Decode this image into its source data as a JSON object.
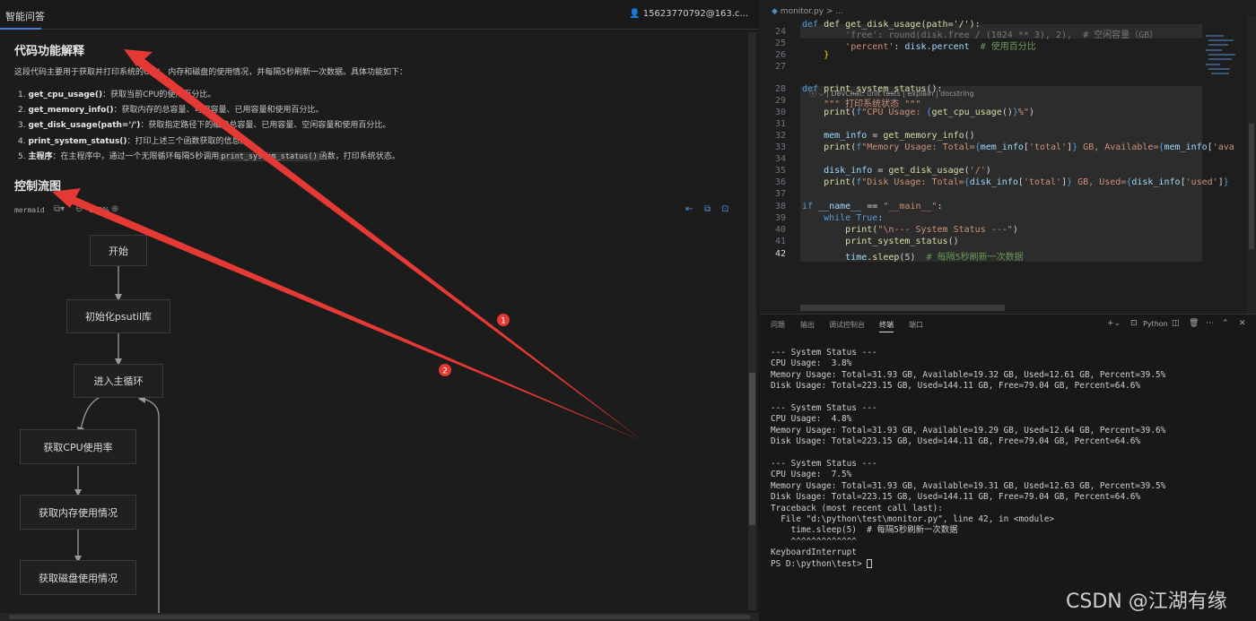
{
  "left_panel": {
    "tab_title": "智能问答",
    "user": "15623770792@163.c...",
    "section1_title": "代码功能解释",
    "intro": "这段代码主要用于获取并打印系统的CPU、内存和磁盘的使用情况，并每隔5秒刷新一次数据。具体功能如下：",
    "items": [
      {
        "num": "1.",
        "name": "get_cpu_usage()",
        "desc": "：获取当前CPU的使用百分比。"
      },
      {
        "num": "2.",
        "name": "get_memory_info()",
        "desc": "：获取内存的总容量、可用容量、已用容量和使用百分比。"
      },
      {
        "num": "3.",
        "name": "get_disk_usage(path='/')",
        "desc": "：获取指定路径下的磁盘总容量、已用容量、空闲容量和使用百分比。"
      },
      {
        "num": "4.",
        "name": "print_system_status()",
        "desc": "：打印上述三个函数获取的信息。"
      },
      {
        "num": "5.",
        "name": "主程序",
        "desc_a": "：在主程序中，通过一个无限循环每隔5秒调用",
        "code": "print_system_status()",
        "desc_b": "函数，打印系统状态。"
      }
    ],
    "section2_title": "控制流图",
    "mermaid_label": "mermaid",
    "zoom": "100%",
    "flow_nodes": [
      "开始",
      "初始化psutil库",
      "进入主循环",
      "获取CPU使用率",
      "获取内存使用情况",
      "获取磁盘使用情况"
    ]
  },
  "editor": {
    "breadcrumb": "monitor.py > ...",
    "codelens": "ⓘ ⌵ | DevChat: unit tests | explain | docstring",
    "line_numbers": [
      "24",
      "25",
      "26",
      "27",
      "28",
      "29",
      "30",
      "31",
      "32",
      "33",
      "34",
      "35",
      "36",
      "37",
      "38",
      "39",
      "40",
      "41",
      "42"
    ],
    "top_line": "def get_disk_usage(path='/'):"
  },
  "panel": {
    "tabs": [
      "问题",
      "输出",
      "调试控制台",
      "终端",
      "端口"
    ],
    "active_tab": "终端",
    "shell": "Python",
    "terminal_lines": [
      "--- System Status ---",
      "CPU Usage:  3.8%",
      "Memory Usage: Total=31.93 GB, Available=19.32 GB, Used=12.61 GB, Percent=39.5%",
      "Disk Usage: Total=223.15 GB, Used=144.11 GB, Free=79.04 GB, Percent=64.6%",
      "",
      "--- System Status ---",
      "CPU Usage:  4.8%",
      "Memory Usage: Total=31.93 GB, Available=19.29 GB, Used=12.64 GB, Percent=39.6%",
      "Disk Usage: Total=223.15 GB, Used=144.11 GB, Free=79.04 GB, Percent=64.6%",
      "",
      "--- System Status ---",
      "CPU Usage:  7.5%",
      "Memory Usage: Total=31.93 GB, Available=19.31 GB, Used=12.63 GB, Percent=39.5%",
      "Disk Usage: Total=223.15 GB, Used=144.11 GB, Free=79.04 GB, Percent=64.6%",
      "Traceback (most recent call last):",
      "  File \"d:\\python\\test\\monitor.py\", line 42, in <module>",
      "    time.sleep(5)  # 每隔5秒刷新一次数据",
      "    ^^^^^^^^^^^^^",
      "KeyboardInterrupt"
    ],
    "prompt": "PS D:\\python\\test> "
  },
  "annotations": {
    "badge1": "1",
    "badge2": "2",
    "color": "#e53935"
  },
  "watermark": "CSDN @江湖有缘"
}
